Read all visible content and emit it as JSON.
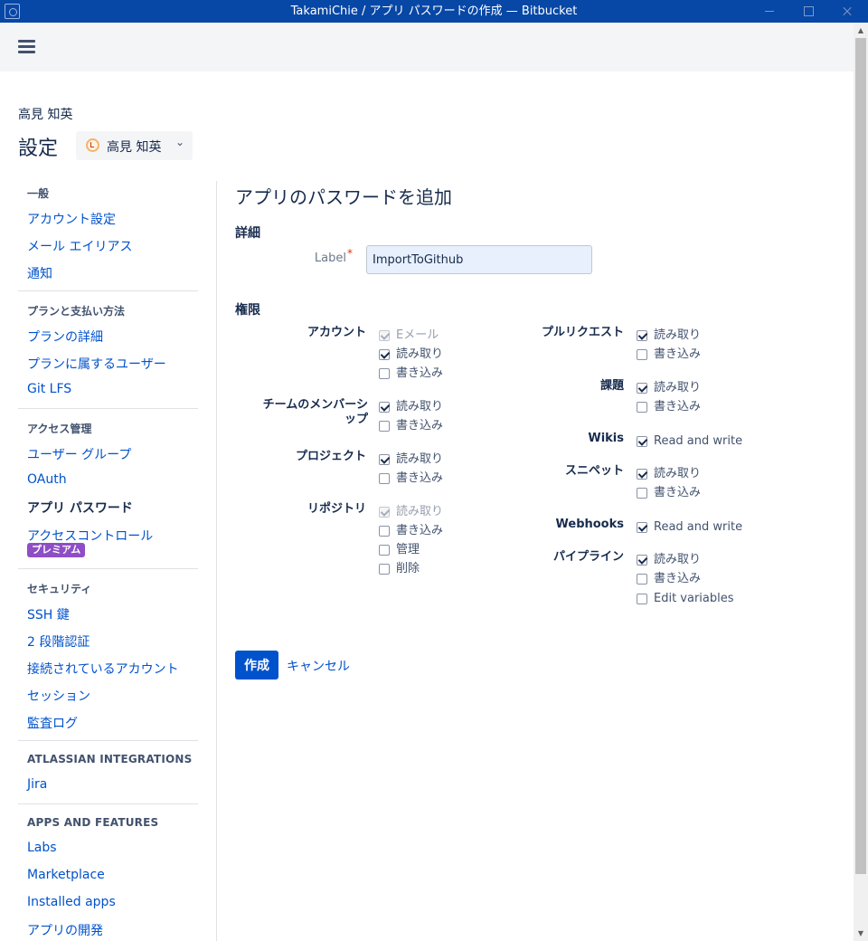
{
  "window": {
    "title": "TakamiChie / アプリ パスワードの作成 — Bitbucket"
  },
  "header": {
    "username": "高見 知英",
    "page_title": "設定",
    "account_select": {
      "value": "高見 知英"
    }
  },
  "sidebar": {
    "general": {
      "heading": "一般",
      "items": [
        "アカウント設定",
        "メール エイリアス",
        "通知"
      ]
    },
    "plans": {
      "heading": "プランと支払い方法",
      "items": [
        "プランの詳細",
        "プランに属するユーザー",
        "Git LFS"
      ]
    },
    "access": {
      "heading": "アクセス管理",
      "items": [
        "ユーザー グループ",
        "OAuth",
        "アプリ パスワード",
        "アクセスコントロール"
      ],
      "active": "アプリ パスワード",
      "badge": "プレミアム"
    },
    "security": {
      "heading": "セキュリティ",
      "items": [
        "SSH 鍵",
        "2 段階認証",
        "接続されているアカウント",
        "セッション",
        "監査ログ"
      ]
    },
    "integrations": {
      "heading": "ATLASSIAN INTEGRATIONS",
      "items": [
        "Jira"
      ]
    },
    "apps": {
      "heading": "APPS AND FEATURES",
      "items": [
        "Labs",
        "Marketplace",
        "Installed apps",
        "アプリの開発"
      ]
    }
  },
  "main": {
    "title": "アプリのパスワードを追加",
    "details_heading": "詳細",
    "label_field": {
      "label": "Label",
      "required_mark": "*",
      "value": "ImportToGithub"
    },
    "permissions_heading": "権限",
    "permissions": {
      "account": {
        "label": "アカウント",
        "options": [
          {
            "label": "Eメール",
            "checked": true,
            "disabled": true
          },
          {
            "label": "読み取り",
            "checked": true
          },
          {
            "label": "書き込み",
            "checked": false
          }
        ]
      },
      "team": {
        "label": "チームのメンバーシップ",
        "options": [
          {
            "label": "読み取り",
            "checked": true
          },
          {
            "label": "書き込み",
            "checked": false
          }
        ]
      },
      "project": {
        "label": "プロジェクト",
        "options": [
          {
            "label": "読み取り",
            "checked": true
          },
          {
            "label": "書き込み",
            "checked": false
          }
        ]
      },
      "repository": {
        "label": "リポジトリ",
        "options": [
          {
            "label": "読み取り",
            "checked": true,
            "disabled": true
          },
          {
            "label": "書き込み",
            "checked": false
          },
          {
            "label": "管理",
            "checked": false
          },
          {
            "label": "削除",
            "checked": false
          }
        ]
      },
      "pullrequest": {
        "label": "プルリクエスト",
        "options": [
          {
            "label": "読み取り",
            "checked": true
          },
          {
            "label": "書き込み",
            "checked": false
          }
        ]
      },
      "issues": {
        "label": "課題",
        "options": [
          {
            "label": "読み取り",
            "checked": true
          },
          {
            "label": "書き込み",
            "checked": false
          }
        ]
      },
      "wikis": {
        "label": "Wikis",
        "options": [
          {
            "label": "Read and write",
            "checked": true
          }
        ]
      },
      "snippets": {
        "label": "スニペット",
        "options": [
          {
            "label": "読み取り",
            "checked": true
          },
          {
            "label": "書き込み",
            "checked": false
          }
        ]
      },
      "webhooks": {
        "label": "Webhooks",
        "options": [
          {
            "label": "Read and write",
            "checked": true
          }
        ]
      },
      "pipelines": {
        "label": "パイプライン",
        "options": [
          {
            "label": "読み取り",
            "checked": true
          },
          {
            "label": "書き込み",
            "checked": false
          },
          {
            "label": "Edit variables",
            "checked": false
          }
        ]
      }
    },
    "create_label": "作成",
    "cancel_label": "キャンセル"
  }
}
